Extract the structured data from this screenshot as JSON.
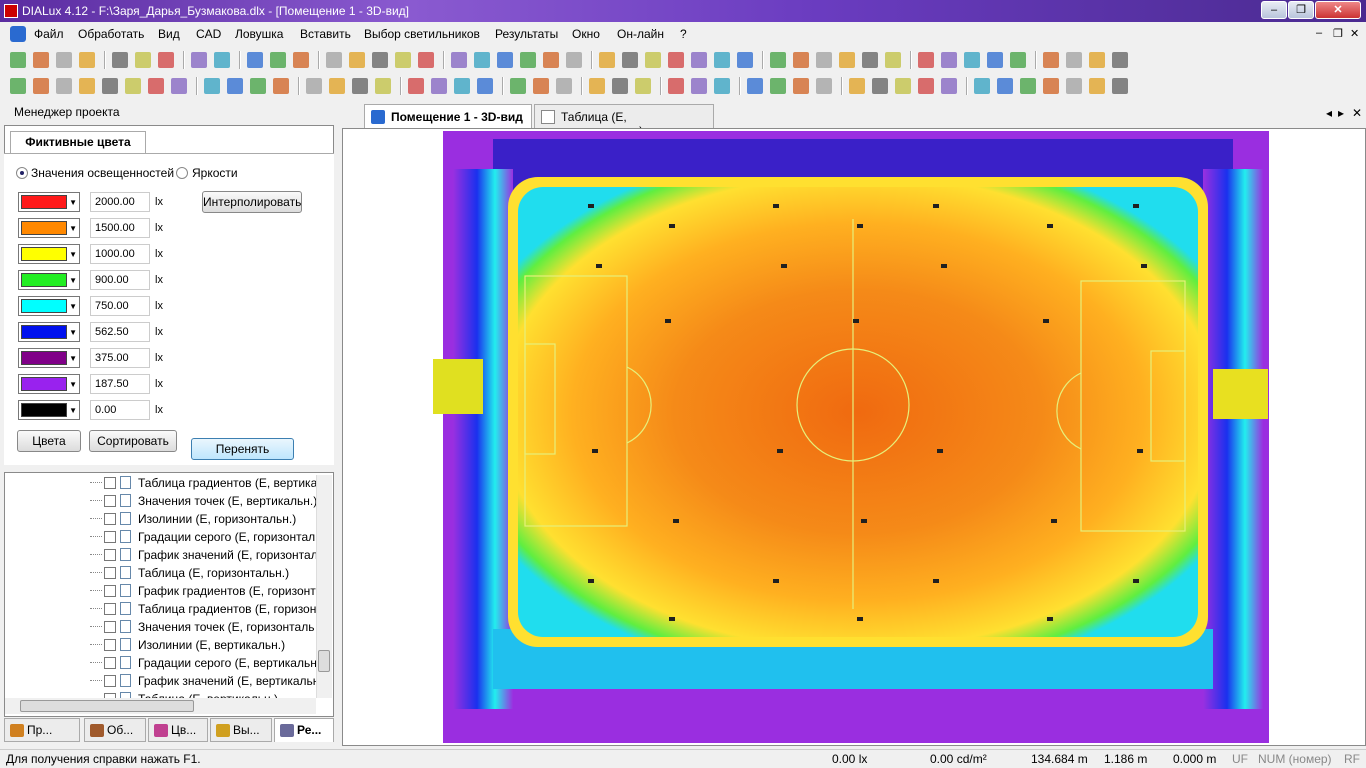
{
  "window": {
    "title": "DIALux 4.12 - F:\\Заря_Дарья_Бузмакова.dlx - [Помещение 1 - 3D-вид]",
    "btn_min": "–",
    "btn_max": "❐",
    "btn_close": "✕"
  },
  "menu": {
    "items": [
      "Файл",
      "Обработать",
      "Вид",
      "CAD",
      "Ловушка",
      "Вставить",
      "Выбор светильников",
      "Результаты",
      "Окно",
      "Он-лайн",
      "?"
    ],
    "mdi_min": "–",
    "mdi_restore": "❐",
    "mdi_close": "✕"
  },
  "project_manager": {
    "label": "Менеджер проекта"
  },
  "false_colors": {
    "tab_label": "Фиктивные цвета",
    "radio_illuminance": "Значения освещенностей",
    "radio_luminance": "Яркости",
    "interpolate_label": "Интерполировать",
    "unit": "lx",
    "rows": [
      {
        "color": "#ff1a1a",
        "value": "2000.00"
      },
      {
        "color": "#ff8800",
        "value": "1500.00"
      },
      {
        "color": "#ffff00",
        "value": "1000.00"
      },
      {
        "color": "#22ee22",
        "value": "900.00"
      },
      {
        "color": "#00ffff",
        "value": "750.00"
      },
      {
        "color": "#0011ee",
        "value": "562.50"
      },
      {
        "color": "#800088",
        "value": "375.00"
      },
      {
        "color": "#9922ee",
        "value": "187.50"
      },
      {
        "color": "#000000",
        "value": "0.00"
      }
    ],
    "colors_btn": "Цвета",
    "sort_btn": "Сортировать",
    "apply_btn": "Перенять"
  },
  "tree": {
    "items": [
      "Таблица градиентов (E, вертикаль",
      "Значения точек (E, вертикальн.)",
      "Изолинии (E, горизонтальн.)",
      "Градации серого (E, горизонтал",
      "График значений (E, горизонтал",
      "Таблица (E, горизонтальн.)",
      "График градиентов (E, горизонт",
      "Таблица градиентов (E, горизон",
      "Значения точек (E, горизонталь",
      "Изолинии (E, вертикальн.)",
      "Градации серого (E, вертикальн",
      "График значений (E, вертикальн",
      "Таблица (E, вертикальн.)"
    ]
  },
  "bottom_tabs": [
    {
      "label": "Пр...",
      "icon": "project-icon",
      "color": "#d08020"
    },
    {
      "label": "Об...",
      "icon": "objects-icon",
      "color": "#a05a2c"
    },
    {
      "label": "Цв...",
      "icon": "colors-icon",
      "color": "#c04090"
    },
    {
      "label": "Вы...",
      "icon": "luminaires-icon",
      "color": "#d0a020"
    },
    {
      "label": "Ре...",
      "icon": "results-icon",
      "color": "#6a6a9a"
    }
  ],
  "doc_tabs": [
    {
      "label": "Помещение 1 - 3D-вид",
      "icon": "3d-cube-icon"
    },
    {
      "label": "Таблица (E, горизонтальн.)",
      "icon": "table-icon"
    }
  ],
  "doc_nav": {
    "prev": "◂",
    "next": "▸",
    "close": "✕"
  },
  "colors": {
    "accent": "#3060c0",
    "titlebar": "#6a3cc0"
  },
  "status": {
    "help": "Для получения справки нажать F1.",
    "lx": "0.00 lx",
    "cd": "0.00 cd/m²",
    "x": "134.684 m",
    "y": "1.186 m",
    "z": "0.000 m",
    "uf": "UF",
    "num": "NUM (номер)",
    "rf": "RF"
  }
}
